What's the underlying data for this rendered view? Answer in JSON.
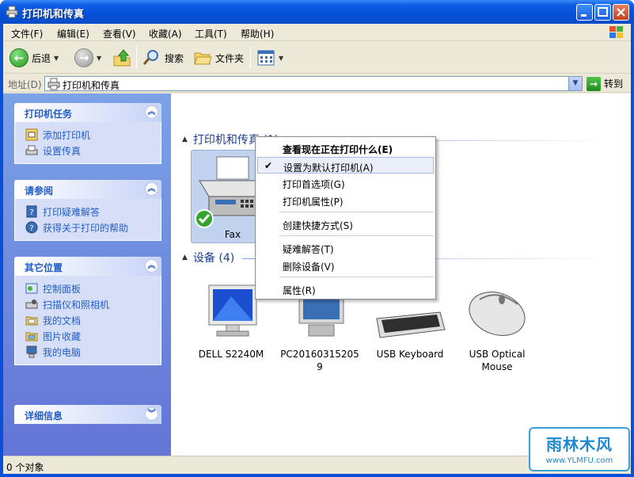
{
  "window": {
    "title": "打印机和传真"
  },
  "menu": [
    "文件(F)",
    "编辑(E)",
    "查看(V)",
    "收藏(A)",
    "工具(T)",
    "帮助(H)"
  ],
  "toolbar": {
    "back": "后退",
    "search": "搜索",
    "folders": "文件夹"
  },
  "address": {
    "label": "地址(D)",
    "value": "打印机和传真",
    "go": "转到"
  },
  "sidebar": {
    "printer_tasks": {
      "title": "打印机任务",
      "items": [
        "添加打印机",
        "设置传真"
      ]
    },
    "see_also": {
      "title": "请参阅",
      "items": [
        "打印疑难解答",
        "获得关于打印的帮助"
      ]
    },
    "other_places": {
      "title": "其它位置",
      "items": [
        "控制面板",
        "扫描仪和照相机",
        "我的文档",
        "图片收藏",
        "我的电脑"
      ]
    },
    "details": {
      "title": "详细信息"
    }
  },
  "groups": {
    "printers": {
      "title": "打印机和传真 (1)",
      "items": [
        "Fax"
      ]
    },
    "devices": {
      "title": "设备 (4)",
      "items": [
        "DELL S2240M",
        "PC20160315205 9",
        "USB Keyboard",
        "USB Optical Mouse"
      ]
    }
  },
  "context_menu": {
    "items": [
      "查看现在正在打印什么(E)",
      "设置为默认打印机(A)",
      "打印首选项(G)",
      "打印机属性(P)",
      "创建快捷方式(S)",
      "疑难解答(T)",
      "删除设备(V)",
      "属性(R)"
    ],
    "checked": "设置为默认打印机(A)"
  },
  "status": {
    "text": "0 个对象"
  },
  "watermark": {
    "title": "雨林木风",
    "url": "www.YLMFU.com"
  }
}
